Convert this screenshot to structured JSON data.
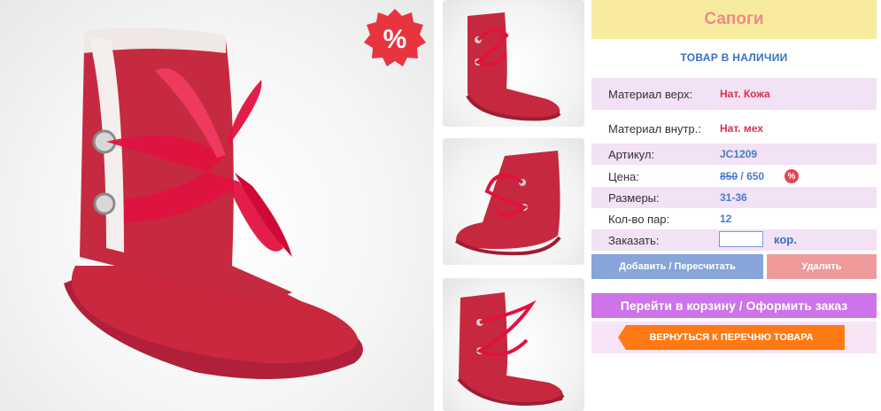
{
  "product": {
    "title": "Сапоги",
    "stock_status": "ТОВАР В НАЛИЧИИ",
    "sale_badge_text": "%",
    "accent_color": "#c8283e"
  },
  "details": [
    {
      "label": "Материал верх:",
      "value": "Нат. Кожа"
    },
    {
      "label": "Материал внутр.:",
      "value": "Нат. мех"
    },
    {
      "label": "Артикул:",
      "value": "JC1209"
    },
    {
      "label": "Цена:",
      "old_price": "850",
      "separator": "/",
      "new_price": "650",
      "badge": "%"
    },
    {
      "label": "Размеры:",
      "value": "31-36"
    },
    {
      "label": "Кол-во пар:",
      "value": "12"
    },
    {
      "label": "Заказать:",
      "input_value": "",
      "unit": "кор."
    }
  ],
  "buttons": {
    "add_label": "Добавить / Пересчитать",
    "delete_label": "Удалить",
    "cart_label": "Перейти в корзину / Оформить заказ",
    "back_label": "ВЕРНУТЬСЯ К ПЕРЕЧНЮ ТОВАРА"
  },
  "colors": {
    "title_bg": "#f7ec9d",
    "row_pink": "#f3e1f5",
    "add_button": "#87a5d8",
    "delete_button": "#ef9a9a",
    "cart_button": "#cd74e8",
    "back_button": "#ff7a14"
  }
}
